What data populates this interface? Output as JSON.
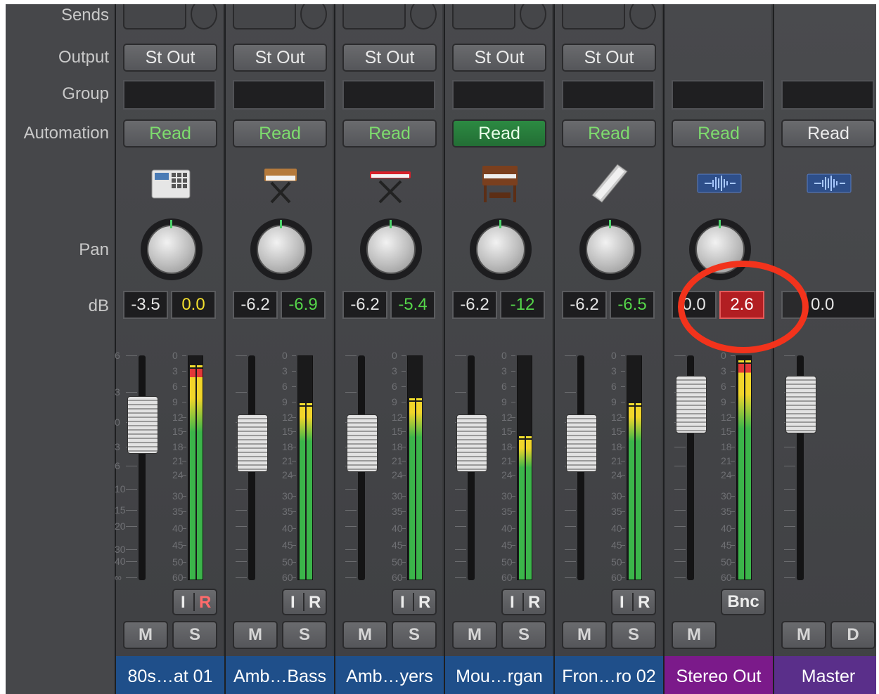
{
  "labels": {
    "sends": "Sends",
    "output": "Output",
    "group": "Group",
    "automation": "Automation",
    "pan": "Pan",
    "db": "dB"
  },
  "scale": {
    "left_ticks": [
      "6",
      "3",
      "0",
      "3",
      "6",
      "10",
      "15",
      "20",
      "30",
      "40",
      "∞"
    ],
    "meter_ticks": [
      "0",
      "3",
      "6",
      "9",
      "12",
      "15",
      "18",
      "21",
      "24",
      "30",
      "35",
      "40",
      "45",
      "50",
      "60"
    ]
  },
  "channels": [
    {
      "name": "80s…at 01",
      "output": "St Out",
      "automation": "Read",
      "automation_active": false,
      "icon": "drum-machine-icon",
      "volume_db": "-3.5",
      "peak_db": "0.0",
      "peak_color": "yellow",
      "fader_level": 0.31,
      "meter_level": 0.95,
      "input_label": "I",
      "record_label": "R",
      "record_armed": true,
      "mute_label": "M",
      "solo_label": "S",
      "color": "#1f4f8a"
    },
    {
      "name": "Amb…Bass",
      "output": "St Out",
      "automation": "Read",
      "automation_active": false,
      "icon": "synth-keyboard-icon",
      "volume_db": "-6.2",
      "peak_db": "-6.9",
      "peak_color": "green",
      "fader_level": 0.39,
      "meter_level": 0.78,
      "input_label": "I",
      "record_label": "R",
      "record_armed": false,
      "mute_label": "M",
      "solo_label": "S",
      "color": "#1f4f8a"
    },
    {
      "name": "Amb…yers",
      "output": "St Out",
      "automation": "Read",
      "automation_active": false,
      "icon": "stage-piano-icon",
      "volume_db": "-6.2",
      "peak_db": "-5.4",
      "peak_color": "green",
      "fader_level": 0.39,
      "meter_level": 0.8,
      "input_label": "I",
      "record_label": "R",
      "record_armed": false,
      "mute_label": "M",
      "solo_label": "S",
      "color": "#1f4f8a"
    },
    {
      "name": "Mou…rgan",
      "output": "St Out",
      "automation": "Read",
      "automation_active": true,
      "icon": "organ-icon",
      "volume_db": "-6.2",
      "peak_db": "-12",
      "peak_color": "green",
      "fader_level": 0.39,
      "meter_level": 0.63,
      "input_label": "I",
      "record_label": "R",
      "record_armed": false,
      "mute_label": "M",
      "solo_label": "S",
      "color": "#1f4f8a"
    },
    {
      "name": "Fron…ro 02",
      "output": "St Out",
      "automation": "Read",
      "automation_active": false,
      "icon": "slide-tube-icon",
      "volume_db": "-6.2",
      "peak_db": "-6.5",
      "peak_color": "green",
      "fader_level": 0.39,
      "meter_level": 0.78,
      "input_label": "I",
      "record_label": "R",
      "record_armed": false,
      "mute_label": "M",
      "solo_label": "S",
      "color": "#1f4f8a"
    },
    {
      "name": "Stereo Out",
      "output": "",
      "automation": "Read",
      "automation_active": false,
      "icon": "waveform-icon",
      "volume_db": "0.0",
      "peak_db": "2.6",
      "peak_color": "red",
      "fader_level": 0.22,
      "meter_level": 0.97,
      "bounce_label": "Bnc",
      "mute_label": "M",
      "color": "#7b1a8a"
    },
    {
      "name": "Master",
      "output": "",
      "automation": "Read",
      "automation_active": false,
      "icon": "waveform-icon",
      "volume_db": "0.0",
      "fader_level": 0.22,
      "mute_label": "M",
      "dim_label": "D",
      "color": "#5a2f8a"
    }
  ]
}
